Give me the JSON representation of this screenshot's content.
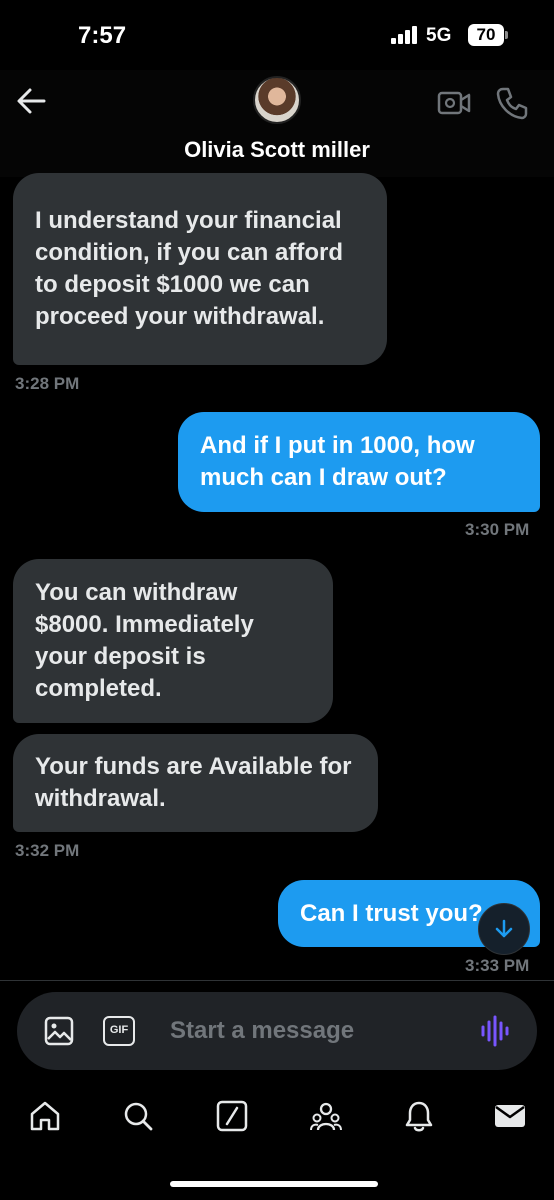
{
  "status_bar": {
    "time": "7:57",
    "network": "5G",
    "battery": "70"
  },
  "header": {
    "contact_name": "Olivia Scott miller",
    "icons": [
      "back-arrow-icon",
      "video-call-icon",
      "phone-call-icon"
    ]
  },
  "messages": [
    {
      "direction": "incoming",
      "text": "I understand your financial condition, if you can afford to deposit $1000 we can proceed your withdrawal."
    },
    {
      "direction": "incoming_timestamp",
      "text": "3:28 PM"
    },
    {
      "direction": "outgoing",
      "text": "And if I put in 1000, how much can I draw out?"
    },
    {
      "direction": "outgoing_timestamp",
      "text": "3:30 PM"
    },
    {
      "direction": "incoming",
      "text": "You can withdraw $8000. Immediately your deposit is completed."
    },
    {
      "direction": "incoming",
      "text": "Your funds are Available for withdrawal."
    },
    {
      "direction": "incoming_timestamp",
      "text": "3:32 PM"
    },
    {
      "direction": "outgoing",
      "text": "Can I trust you?"
    },
    {
      "direction": "outgoing_timestamp",
      "text": "3:33 PM"
    }
  ],
  "composer": {
    "placeholder": "Start a message",
    "gif_label": "GIF",
    "accent_color": "#7856ff"
  },
  "bottom_nav": [
    "home-icon",
    "search-icon",
    "grok-icon",
    "communities-icon",
    "notifications-icon",
    "messages-icon"
  ],
  "colors": {
    "outgoing_bubble": "#1d9bf0",
    "incoming_bubble": "#2f3336",
    "background": "#000000"
  }
}
